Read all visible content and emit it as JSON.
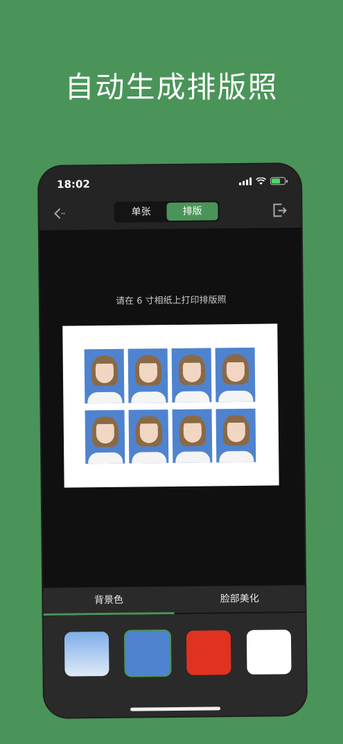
{
  "headline": "自动生成排版照",
  "status": {
    "time": "18:02"
  },
  "nav": {
    "segments": [
      "单张",
      "排版"
    ],
    "active_segment": 1
  },
  "preview": {
    "hint": "请在 6 寸相纸上打印排版照",
    "photo_count": 8
  },
  "tabs": [
    {
      "label": "背景色",
      "active": true
    },
    {
      "label": "脸部美化",
      "active": false
    }
  ],
  "swatches": [
    {
      "name": "light-blue",
      "color": "#9cc3ee",
      "selected": false
    },
    {
      "name": "blue",
      "color": "#4f83cf",
      "selected": true
    },
    {
      "name": "red",
      "color": "#e0321f",
      "selected": false
    },
    {
      "name": "white",
      "color": "#ffffff",
      "selected": false
    }
  ],
  "colors": {
    "accent": "#4a9459",
    "background": "#4a9459"
  }
}
